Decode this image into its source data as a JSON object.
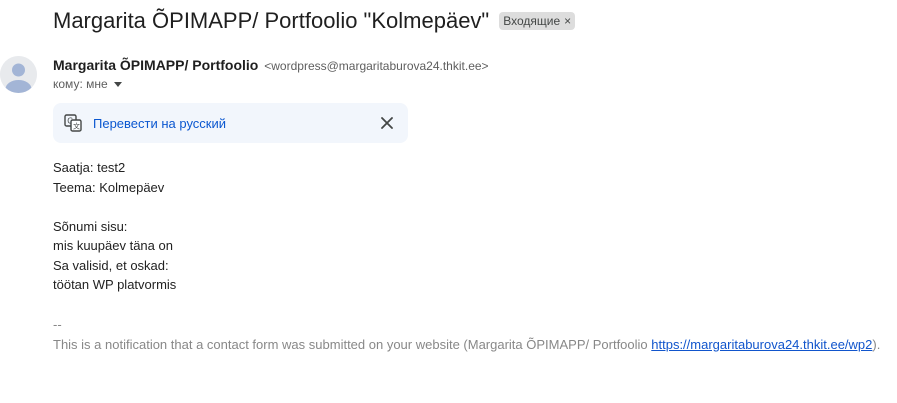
{
  "email": {
    "subject": "Margarita ÕPIMAPP/ Portfoolio \"Kolmepäev\"",
    "label": "Входящие",
    "label_remove": "×",
    "sender_name": "Margarita ÕPIMAPP/ Portfoolio",
    "sender_email": "<wordpress@margaritaburova24.thkit.ee>",
    "to": "кому: мне"
  },
  "translate": {
    "link": "Перевести на русский",
    "close": "✕"
  },
  "body": {
    "lines": [
      "Saatja: test2",
      "Teema: Kolmepäev",
      "",
      "Sõnumi sisu:",
      "mis kuupäev täna on",
      "Sa valisid, et oskad:",
      "töötan WP platvormis"
    ],
    "signature_dash": "--",
    "footer_text": "This is a notification that a contact form was submitted on your website (Margarita ÕPIMAPP/ Portfoolio ",
    "footer_link": "https://margaritaburova24.thkit.ee/wp2",
    "footer_end": ")."
  }
}
